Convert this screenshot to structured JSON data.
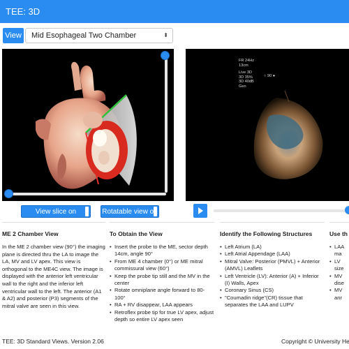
{
  "header": {
    "title": "TEE: 3D"
  },
  "view": {
    "label": "View",
    "selected": "Mid Esophageal Two Chamber",
    "caret": "⬍"
  },
  "controls": {
    "view_slice_label": "View slice on",
    "rotatable_label": "Rotatable view on"
  },
  "echo": {
    "freq": "FR 24Hz",
    "depth": "13cm",
    "mode": "Live 3D",
    "gain": "3D 35%",
    "db": "3D 40dB",
    "gen": "Gen",
    "angle_icon": "○",
    "angle": "90",
    "angle_dot": "●"
  },
  "sections": {
    "s1": {
      "title": "ME 2 Chamber View",
      "body": "In the ME 2 chamber view (90°) the imaging plane is directed thru the LA to image the LA, MV and LV apex. This view is orthogonal to the ME4C view. The image is displayed with the anterior left ventricular wall to the right and the inferior left ventricular wall to the left. The anterior (A1 & A2) and posterior (P3) segments of the mitral valve are seen in this view."
    },
    "s2": {
      "title": "To Obtain the View",
      "items": [
        "Insert the probe to the ME, sector depth 14cm, angle 90°",
        "From ME 4 chamber (0°) or ME mitral commissural view (60°)",
        "Keep the probe tip still and the MV in the center",
        "Rotate omniplane angle forward to 80-100°",
        "RA + RV disappear, LAA appears",
        "Retroflex probe tip for true LV apex, adjust depth so entire LV apex seen"
      ]
    },
    "s3": {
      "title": "Identify the Following Structures",
      "items": [
        "Left Atrium (LA)",
        "Left Atrial Appendage (LAA)",
        "Mitral Valve: Posterior (PMVL) + Anterior (AMVL) Leaflets",
        "Left Ventricle (LV): Anterior (A) + Inferior (I) Walls, Apex",
        "Coronary Sinus (CS)",
        "\"Coumadin ridge\"(CR) tissue that separates the LAA and LUPV"
      ]
    },
    "s4": {
      "title": "Use th",
      "items": [
        "LAA ma",
        "LV size",
        "MV dise",
        "MV anr"
      ]
    }
  },
  "footer": {
    "left": "TEE: 3D Standard Views. Version 2.06",
    "right": "Copyright © University Healt"
  },
  "colors": {
    "accent": "#2a8cf0",
    "header": "#2a8cf0",
    "panel_bg": "#000000"
  },
  "icons": {
    "play": "play-icon",
    "select": "select-caret-icon"
  }
}
